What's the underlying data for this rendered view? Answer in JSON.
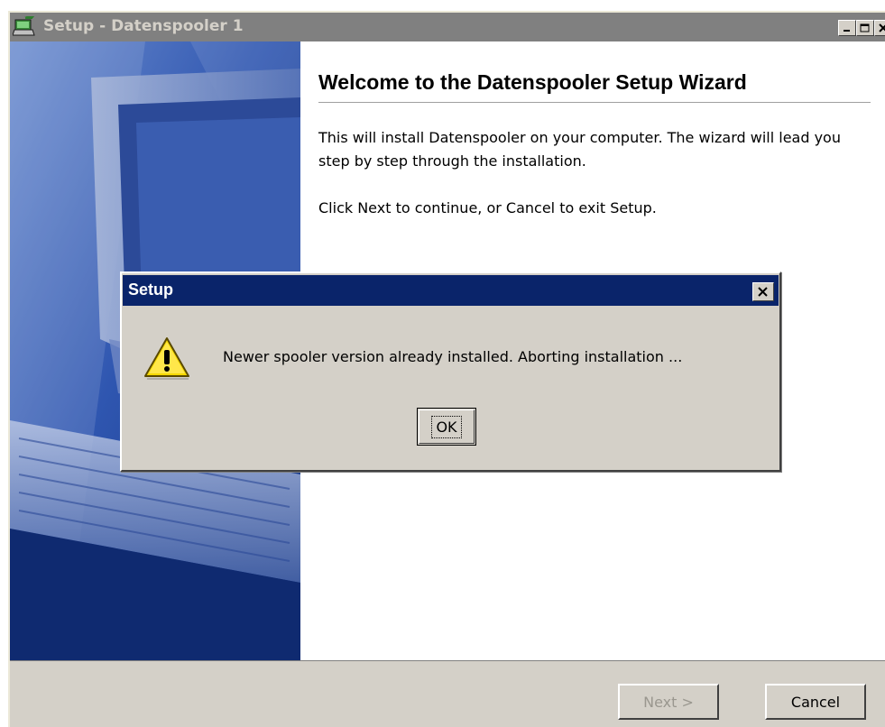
{
  "window": {
    "title": "Setup - Datenspooler 1",
    "icon": "setup-icon",
    "controls": [
      "minimize-icon",
      "maximize-icon",
      "close-icon"
    ]
  },
  "banner": {
    "image": "computer-keyboard-illustration"
  },
  "wizard": {
    "heading": "Welcome to the Datenspooler Setup Wizard",
    "paragraph1": "This will install Datenspooler on your computer. The wizard will lead you step by step through the installation.",
    "paragraph2": "Click Next to continue, or Cancel to exit Setup."
  },
  "buttons": {
    "next": "Next >",
    "cancel": "Cancel"
  },
  "dialog": {
    "title": "Setup",
    "icon": "warning-icon",
    "message": "Newer spooler version already installed. Aborting installation ...",
    "ok": "OK"
  },
  "colors": {
    "inactive_titlebar": "#808080",
    "active_titlebar": "#0a246a",
    "face": "#d4d0c8",
    "banner": "#1a3d8c"
  }
}
